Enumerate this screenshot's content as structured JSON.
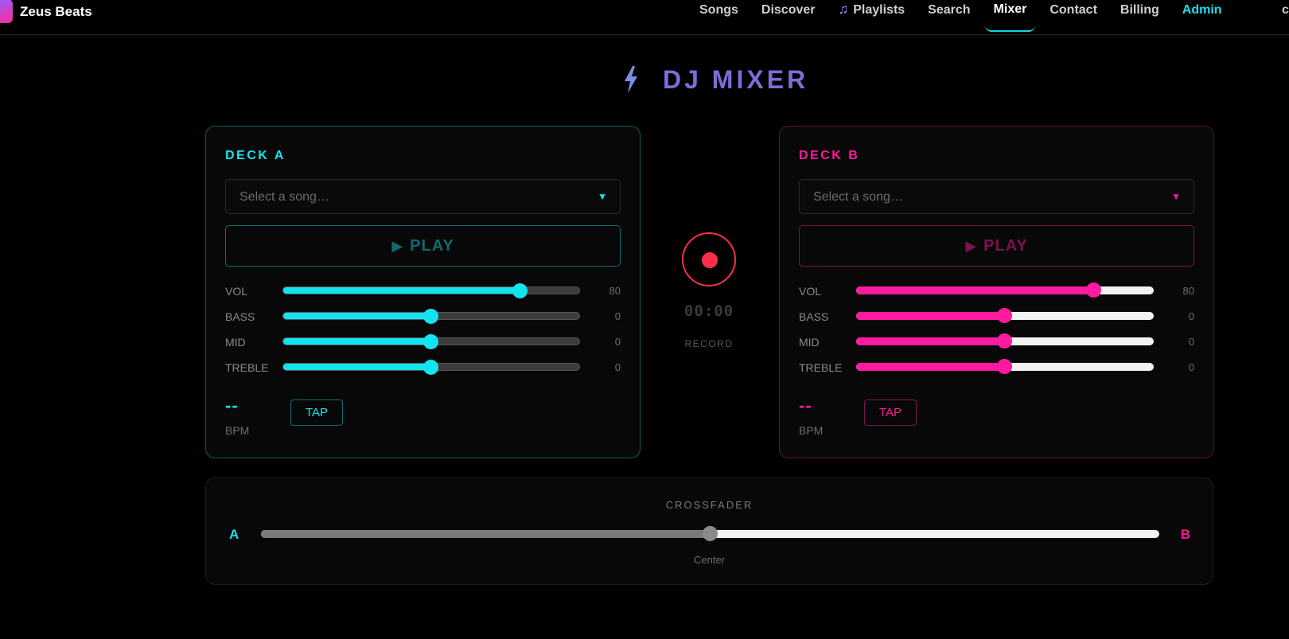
{
  "brand": {
    "name": "Zeus Beats"
  },
  "nav": {
    "items": [
      {
        "label": "Songs"
      },
      {
        "label": "Discover"
      },
      {
        "label": "Playlists"
      },
      {
        "label": "Search"
      },
      {
        "label": "Mixer",
        "active": true
      },
      {
        "label": "Contact"
      },
      {
        "label": "Billing"
      },
      {
        "label": "Admin"
      }
    ],
    "edge_glyph": "c"
  },
  "page": {
    "title": "DJ MIXER"
  },
  "decks": {
    "a": {
      "title": "DECK A",
      "select_placeholder": "Select a song…",
      "select_caret": "▼",
      "play_icon": "▶",
      "play_label": "PLAY",
      "sliders": [
        {
          "label": "VOL",
          "value": "80",
          "level": 80
        },
        {
          "label": "BASS",
          "value": "0",
          "level": 50
        },
        {
          "label": "MID",
          "value": "0",
          "level": 50
        },
        {
          "label": "TREBLE",
          "value": "0",
          "level": 50
        }
      ],
      "bpm_value": "--",
      "bpm_label": "BPM",
      "tap_label": "TAP"
    },
    "b": {
      "title": "DECK B",
      "select_placeholder": "Select a song…",
      "select_caret": "▼",
      "play_icon": "▶",
      "play_label": "PLAY",
      "sliders": [
        {
          "label": "VOL",
          "value": "80",
          "level": 80
        },
        {
          "label": "BASS",
          "value": "0",
          "level": 50
        },
        {
          "label": "MID",
          "value": "0",
          "level": 50
        },
        {
          "label": "TREBLE",
          "value": "0",
          "level": 50
        }
      ],
      "bpm_value": "--",
      "bpm_label": "BPM",
      "tap_label": "TAP"
    }
  },
  "record": {
    "time": "00:00",
    "label": "RECORD"
  },
  "crossfader": {
    "title": "CROSSFADER",
    "left_label": "A",
    "right_label": "B",
    "position_label": "Center",
    "level": 50
  },
  "colors": {
    "deck_a": "#12e4ef",
    "deck_b": "#ff1a9a",
    "record": "#ff2d4a",
    "title": "#7e6cd8"
  },
  "icons": {
    "title_icon": "lightning-bolt-icon",
    "playlists_icon": "music-note-icon",
    "record_icon": "record-icon",
    "play_icon": "play-icon",
    "caret_icon": "caret-down-icon"
  }
}
